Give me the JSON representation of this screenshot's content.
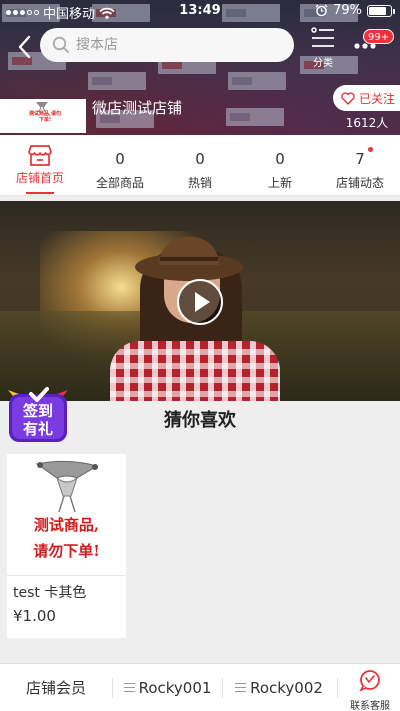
{
  "status_bar": {
    "carrier": "中国移动",
    "time": "13:49",
    "battery": "79%",
    "battery_level": 0.79
  },
  "header": {
    "search_placeholder": "搜本店",
    "category_label": "分类",
    "message_badge": "99+"
  },
  "shop": {
    "name": "微店测试店铺",
    "logo_text": "测试商品,请勿下单!",
    "follow_label": "已关注",
    "followers": "1612人"
  },
  "tabs": [
    {
      "label": "店铺首页",
      "count": "",
      "active": true,
      "icon": "store-icon"
    },
    {
      "label": "全部商品",
      "count": "0",
      "active": false
    },
    {
      "label": "热销",
      "count": "0",
      "active": false
    },
    {
      "label": "上新",
      "count": "0",
      "active": false
    },
    {
      "label": "店铺动态",
      "count": "7",
      "active": false,
      "has_dot": true
    }
  ],
  "video": {
    "icon": "play-icon"
  },
  "promo": {
    "badge_line1": "签到",
    "badge_line2": "有礼"
  },
  "section": {
    "title": "猜你喜欢"
  },
  "products": [
    {
      "image_text_line1": "测试商品,",
      "image_text_line2": "请勿下单!",
      "name": "test 卡其色",
      "price": "¥1.00"
    }
  ],
  "bottom_bar": {
    "items": [
      "店铺会员",
      "Rocky001",
      "Rocky002"
    ],
    "service_label": "联系客服"
  },
  "colors": {
    "accent": "#e8333c",
    "background": "#eeeeee"
  }
}
